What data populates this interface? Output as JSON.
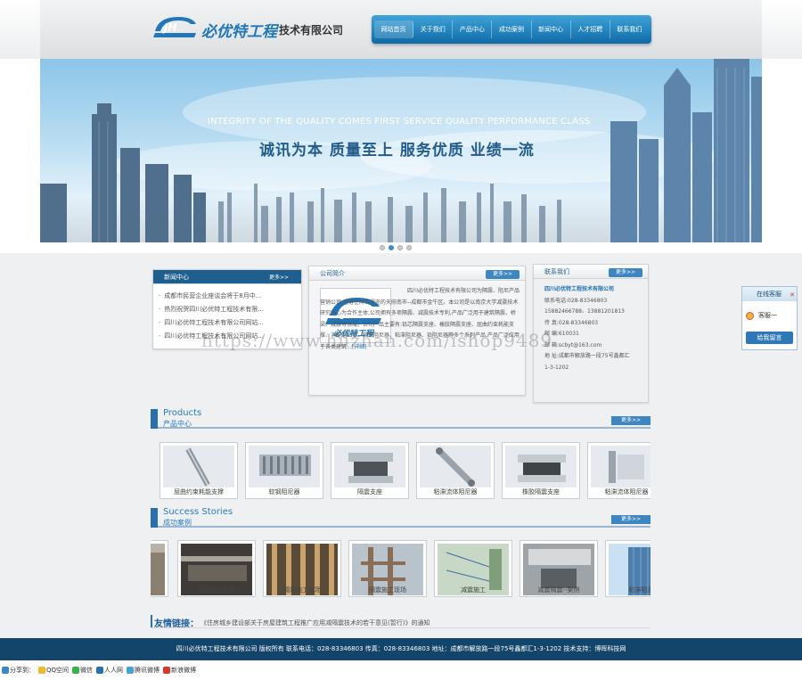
{
  "header": {
    "logo_text": "必优特工程",
    "logo_suffix": "技术有限公司",
    "nav": [
      "网站首页",
      "关于我们",
      "产品中心",
      "成功案例",
      "新闻中心",
      "人才招聘",
      "联系我们"
    ]
  },
  "banner": {
    "en_slogan": "INTEGRITY OF THE   QUALITY COMES FIRST   SERVICE QUALITY   PERFORMANCE CLASS",
    "cn_slogan": "诚讯为本  质量至上  服务优质  业绩一流",
    "slides": 4,
    "active_slide": 2
  },
  "news": {
    "title": "新闻中心",
    "more": "更多>>",
    "items": [
      "成都市民营企业座谈会将于8月中...",
      "热烈祝贺四川必优特工程技术有限...",
      "四川必优特工程技术有限公司网站...",
      "四川必优特工程技术有限公司网站..."
    ]
  },
  "about": {
    "title": "公司简介",
    "more": "更多>>",
    "text": "四川必优特工程技术有限公司为隔震、阻尼产品营销公司,坐落在闻名遐迩的天府南市--成都市金牛区。本公司是以南京大学减震技术研究中心为合作主体,公司拥有多项隔震、减震技术专利,产品广泛用于建筑隔震、桥梁、减震等领域。公司产品主要有:铅芯隔震支座、橡胶隔震支座、屈曲约束耗能支撑、消能阻尼器、软钢阻尼器、粘滞阻尼器、铅阻尼器等多个系列产品,产品广泛应用于各类建筑...",
    "more_link": "[详细]"
  },
  "contact": {
    "title": "联系我们",
    "more": "更多>>",
    "company": "四川必优特工程技术有限公司",
    "lines": [
      "联系电话:028-83346803",
      "15882466788、13881201813",
      "传 真:028-83346803",
      "邮 编:610031",
      "邮 箱:scbyt@163.com",
      "地 址:成都市解放路一段75号鑫都汇",
      "1-3-1202"
    ]
  },
  "products": {
    "title_en": "Products",
    "title_cn": "产品中心",
    "more": "更多>>",
    "items": [
      "屈曲约束耗能支撑",
      "软钢阻尼器",
      "隔震支座",
      "粘滞流体阻尼器",
      "橡胶隔震支座",
      "粘滞流体阻尼器"
    ]
  },
  "cases": {
    "title_en": "Success Stories",
    "title_cn": "成功案例",
    "more": "更多>>",
    "items": [
      "",
      "隔震施工现场",
      "隔震施工现场",
      "隔震施工现场",
      "减震施工",
      "减震隔震--案例",
      "粘滞阻尼器"
    ]
  },
  "friend_links": {
    "label": "友情链接：",
    "text": "《住房城乡建设部关于房屋建筑工程推广应用减隔震技术的若干意见(暂行)》的通知"
  },
  "footer": {
    "text": "四川必优特工程技术有限公司 版权所有   联系电话：028-83346803  传真：028-83346803   地址：成都市解放路一段75号鑫都汇1-3-1202  技术支持：博晖科技网"
  },
  "share": {
    "label": "分享到：",
    "items": [
      "QQ空间",
      "微信",
      "人人网",
      "腾讯微博",
      "新浪微博"
    ]
  },
  "qq_widget": {
    "title": "在线客服",
    "service": "客服一",
    "message_button": "给我留言"
  },
  "watermark": "https://www.huzhan.com/ishop9489",
  "colors": {
    "nav_blue": "#1a78b9",
    "footer_blue": "#13446a",
    "accent": "#2a7cc0"
  }
}
